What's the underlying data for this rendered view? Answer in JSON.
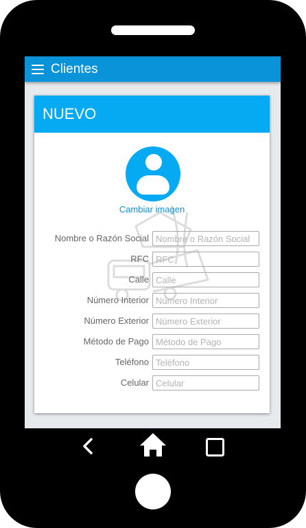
{
  "appbar": {
    "title": "Clientes",
    "menu_icon": "hamburger-menu-icon"
  },
  "card": {
    "title": "NUEVO"
  },
  "avatar": {
    "icon": "user-avatar-icon",
    "change_label": "Cambiar imagen"
  },
  "form": {
    "fields": [
      {
        "label": "Nombre o Razón Social",
        "placeholder": "Nombre o Razón Social",
        "value": ""
      },
      {
        "label": "RFC",
        "placeholder": "RFC",
        "value": ""
      },
      {
        "label": "Calle",
        "placeholder": "Calle",
        "value": ""
      },
      {
        "label": "Número Interior",
        "placeholder": "Número Interior",
        "value": ""
      },
      {
        "label": "Número Exterior",
        "placeholder": "Número Exterior",
        "value": ""
      },
      {
        "label": "Método de Pago",
        "placeholder": "Método de Pago",
        "value": ""
      },
      {
        "label": "Teléfono",
        "placeholder": "Teléfono",
        "value": ""
      },
      {
        "label": "Celular",
        "placeholder": "Celular",
        "value": ""
      }
    ]
  },
  "device": {
    "nav_icons": [
      "back-icon",
      "home-icon",
      "recents-icon"
    ]
  },
  "colors": {
    "appbar": "#0a93d9",
    "card_header": "#06aaf2",
    "accent_text": "#0a93d9",
    "phone_frame": "#000000"
  }
}
